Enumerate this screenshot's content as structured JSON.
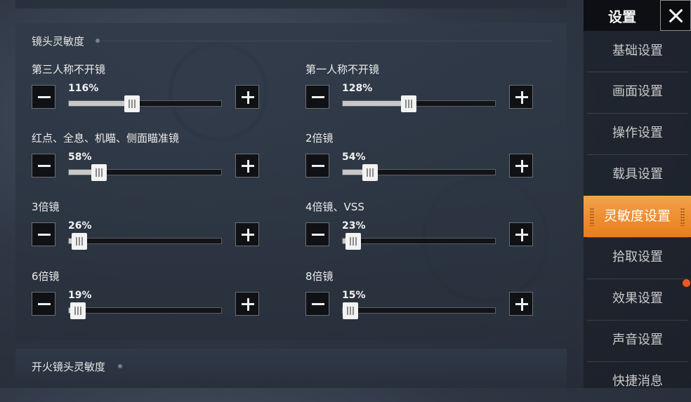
{
  "section": {
    "title": "镜头灵敏度"
  },
  "fire_section": {
    "title": "开火镜头灵敏度"
  },
  "sliders": [
    {
      "label": "第三人称不开镜",
      "percent_label": "116%",
      "level": 0.41
    },
    {
      "label": "第一人称不开镜",
      "percent_label": "128%",
      "level": 0.43
    },
    {
      "label": "红点、全息、机瞄、侧面瞄准镜",
      "percent_label": "58%",
      "level": 0.195
    },
    {
      "label": "2倍镜",
      "percent_label": "54%",
      "level": 0.18
    },
    {
      "label": "3倍镜",
      "percent_label": "26%",
      "level": 0.07
    },
    {
      "label": "4倍镜、VSS",
      "percent_label": "23%",
      "level": 0.07
    },
    {
      "label": "6倍镜",
      "percent_label": "19%",
      "level": 0.06
    },
    {
      "label": "8倍镜",
      "percent_label": "15%",
      "level": 0.045
    }
  ],
  "sidebar": {
    "title": "设置",
    "items": [
      {
        "label": "基础设置"
      },
      {
        "label": "画面设置"
      },
      {
        "label": "操作设置"
      },
      {
        "label": "载具设置"
      },
      {
        "label": "灵敏度设置"
      },
      {
        "label": "拾取设置"
      },
      {
        "label": "效果设置"
      },
      {
        "label": "声音设置"
      },
      {
        "label": "快捷消息"
      }
    ],
    "active_index": 4
  },
  "colors": {
    "accent": "#EE8A2E",
    "notification": "#EE5A1F"
  },
  "icons": {
    "minus": "minus-icon",
    "plus": "plus-icon",
    "close": "close-icon"
  }
}
